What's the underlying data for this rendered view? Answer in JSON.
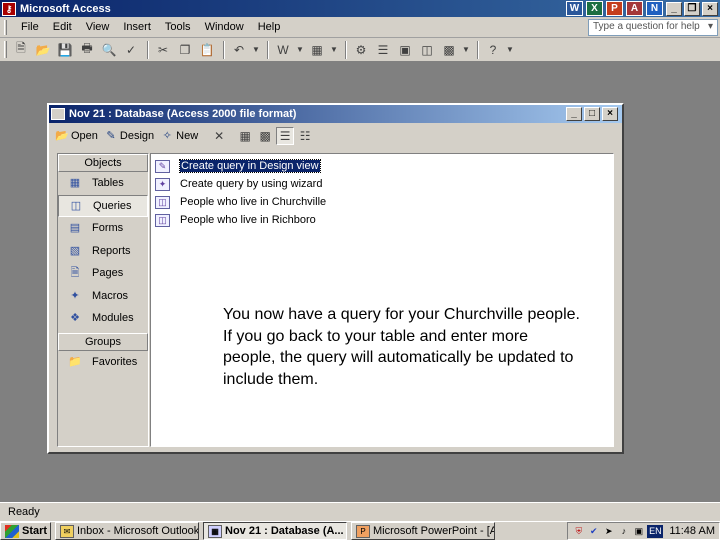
{
  "app": {
    "title": "Microsoft Access",
    "icon": "access-key-icon",
    "office_icons": [
      "W",
      "X",
      "P",
      "A",
      "N"
    ]
  },
  "menu": {
    "items": [
      "File",
      "Edit",
      "View",
      "Insert",
      "Tools",
      "Window",
      "Help"
    ],
    "ask_placeholder": "Type a question for help"
  },
  "toolbar": {
    "icons": [
      "new-icon",
      "open-icon",
      "save-icon",
      "print-icon",
      "preview-icon",
      "spelling-icon",
      "cut-icon",
      "copy-icon",
      "paste-icon",
      "undo-icon",
      "office-links-icon",
      "analyze-icon",
      "code-icon",
      "script-icon",
      "properties-icon",
      "relationships-icon",
      "new-object-icon",
      "help-icon"
    ]
  },
  "db_window": {
    "title": "Nov 21 : Database (Access 2000 file format)",
    "toolbar": {
      "open": "Open",
      "design": "Design",
      "new": "New"
    },
    "objects_header": "Objects",
    "objects": [
      {
        "label": "Tables",
        "icon": "table-icon"
      },
      {
        "label": "Queries",
        "icon": "query-icon",
        "selected": true
      },
      {
        "label": "Forms",
        "icon": "form-icon"
      },
      {
        "label": "Reports",
        "icon": "report-icon"
      },
      {
        "label": "Pages",
        "icon": "page-icon"
      },
      {
        "label": "Macros",
        "icon": "macro-icon"
      },
      {
        "label": "Modules",
        "icon": "module-icon"
      }
    ],
    "groups_header": "Groups",
    "groups": [
      {
        "label": "Favorites",
        "icon": "favorites-folder-icon"
      }
    ],
    "list_items": [
      {
        "label": "Create query in Design view",
        "icon": "design-view-icon",
        "selected": true
      },
      {
        "label": "Create query by using wizard",
        "icon": "wizard-icon"
      },
      {
        "label": "People who live in Churchville",
        "icon": "query-icon"
      },
      {
        "label": "People who live in Richboro",
        "icon": "query-icon"
      }
    ]
  },
  "callout": "You now have a query for your Churchville people.  If you go back to your table and enter more people, the query will automatically be updated to include them.",
  "status": "Ready",
  "taskbar": {
    "start": "Start",
    "tasks": [
      {
        "label": "Inbox - Microsoft Outlook",
        "icon": "outlook-icon"
      },
      {
        "label": "Nov 21 : Database (A...",
        "icon": "access-icon",
        "active": true
      },
      {
        "label": "Microsoft PowerPoint - [Ac...",
        "icon": "powerpoint-icon"
      }
    ],
    "language": "EN",
    "clock": "11:48 AM"
  }
}
